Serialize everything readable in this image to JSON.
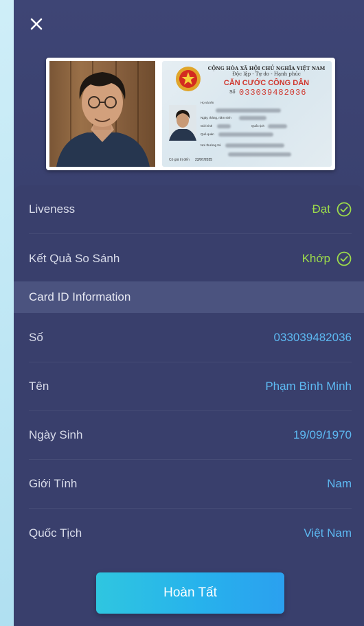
{
  "id_card": {
    "header_line1": "CỘNG HÒA XÃ HỘI CHỦ NGHĨA VIỆT NAM",
    "header_line2": "Độc lập - Tự do - Hạnh phúc",
    "title": "CĂN CƯỚC CÔNG DÂN",
    "number_label": "Số",
    "number": "033039482036",
    "field_name": "Họ và tên",
    "field_dob": "Ngày, tháng, năm sinh",
    "field_sex": "Giới tính",
    "field_nationality": "Quốc tịch",
    "field_hometown": "Quê quán",
    "field_residence": "Nơi thường trú",
    "expiry_label": "Có giá trị đến",
    "expiry": "23/07/2025"
  },
  "checks": [
    {
      "label": "Liveness",
      "value": "Đạt"
    },
    {
      "label": "Kết Quả So Sánh",
      "value": "Khớp"
    }
  ],
  "section_title": "Card ID Information",
  "fields": [
    {
      "label": "Số",
      "value": "033039482036"
    },
    {
      "label": "Tên",
      "value": "Phạm Bình Minh"
    },
    {
      "label": "Ngày Sinh",
      "value": "19/09/1970"
    },
    {
      "label": "Giới Tính",
      "value": "Nam"
    },
    {
      "label": "Quốc Tịch",
      "value": "Việt Nam"
    }
  ],
  "finish_button": "Hoàn Tất",
  "colors": {
    "panel": "#393f6c",
    "accent_blue": "#5db9f2",
    "success_green": "#9ddc4a"
  }
}
